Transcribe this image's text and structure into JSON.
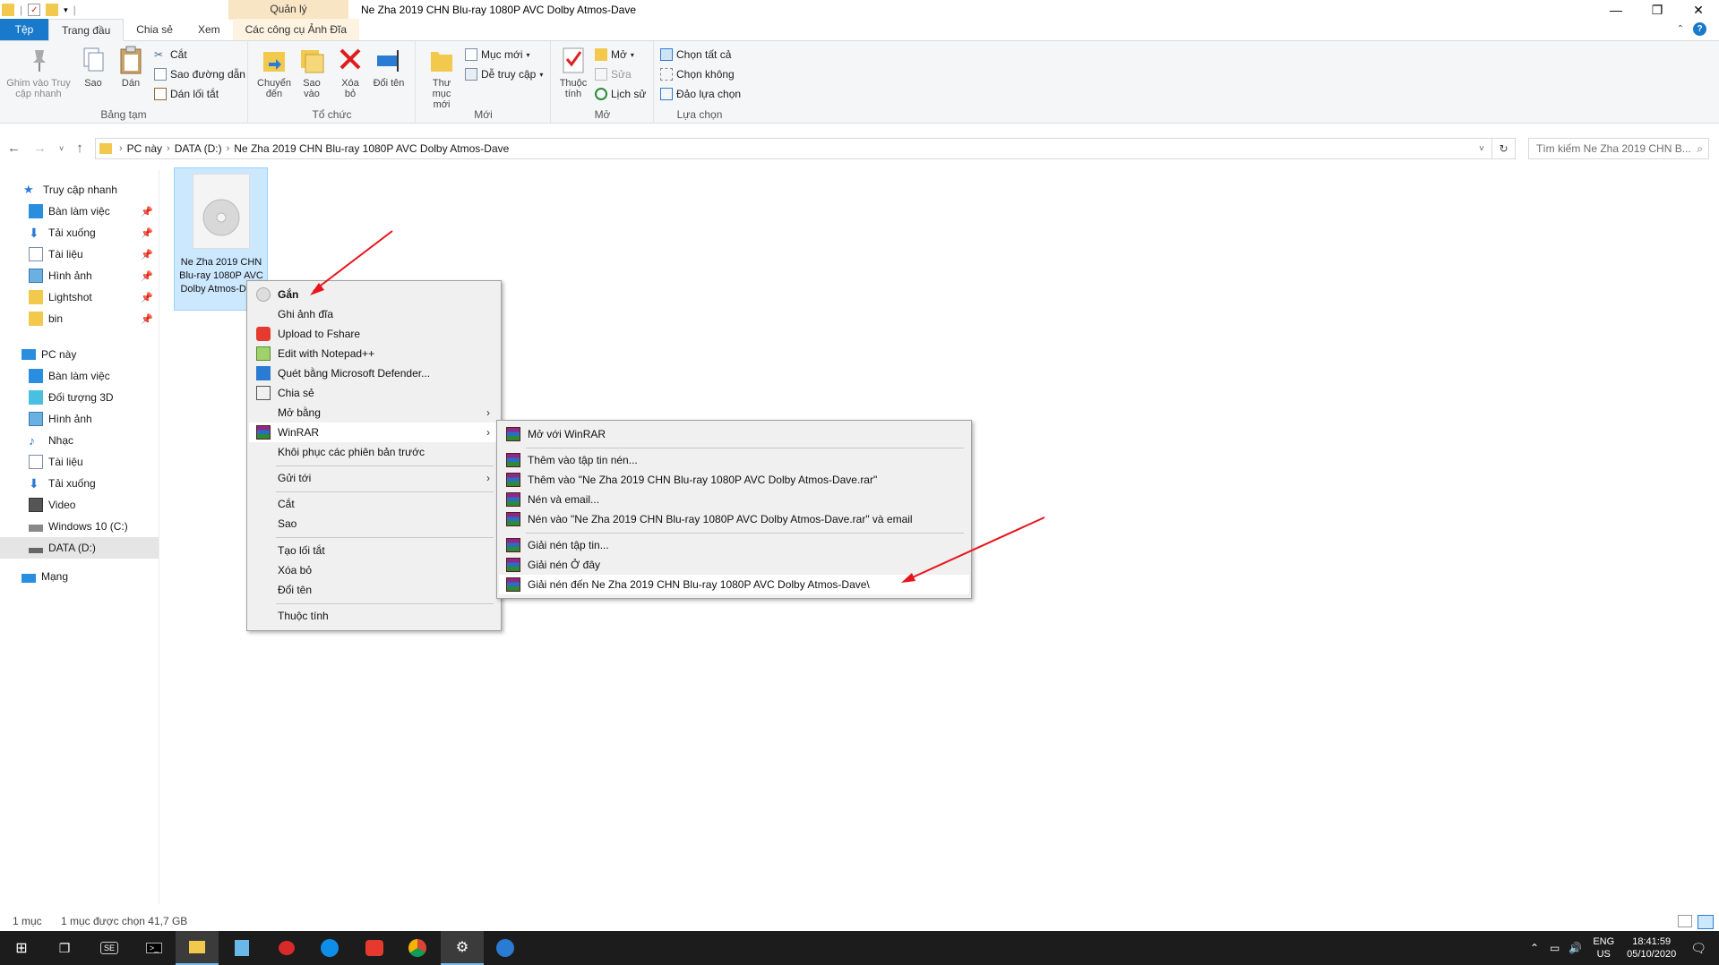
{
  "window": {
    "title": "Ne Zha 2019 CHN Blu-ray 1080P AVC Dolby Atmos-Dave",
    "context_header": "Quản lý"
  },
  "tabs": [
    {
      "label": "Tệp"
    },
    {
      "label": "Trang đầu"
    },
    {
      "label": "Chia sẻ"
    },
    {
      "label": "Xem"
    },
    {
      "label": "Các công cụ Ảnh Đĩa"
    }
  ],
  "ribbon": {
    "clipboard": {
      "pin": "Ghim vào Truy cập nhanh",
      "copy": "Sao",
      "paste": "Dán",
      "cut": "Cắt",
      "copy_path": "Sao đường dẫn",
      "paste_shortcut": "Dán lối tắt",
      "group": "Bảng tạm"
    },
    "organize": {
      "move": "Chuyển đến",
      "copy": "Sao vào",
      "delete": "Xóa bỏ",
      "rename": "Đổi tên",
      "group": "Tổ chức"
    },
    "new": {
      "folder": "Thư mục mới",
      "item": "Mục mới",
      "easy_access": "Dễ truy cập",
      "group": "Mới"
    },
    "open": {
      "properties": "Thuộc tính",
      "open": "Mở",
      "edit": "Sửa",
      "history": "Lịch sử",
      "group": "Mở"
    },
    "select": {
      "all": "Chọn tất cả",
      "none": "Chọn không",
      "invert": "Đảo lựa chọn",
      "group": "Lựa chọn"
    }
  },
  "address": {
    "crumbs": [
      "PC này",
      "DATA (D:)",
      "Ne Zha 2019 CHN Blu-ray 1080P AVC Dolby Atmos-Dave"
    ],
    "search_placeholder": "Tìm kiếm Ne Zha 2019 CHN B..."
  },
  "nav": {
    "quick_access": "Truy cập nhanh",
    "quick_items": [
      "Bàn làm việc",
      "Tải xuống",
      "Tài liệu",
      "Hình ảnh",
      "Lightshot",
      "bin"
    ],
    "this_pc": "PC này",
    "pc_items": [
      "Bàn làm việc",
      "Đối tượng 3D",
      "Hình ảnh",
      "Nhạc",
      "Tài liệu",
      "Tải xuống",
      "Video",
      "Windows 10 (C:)",
      "DATA (D:)"
    ],
    "network": "Mạng"
  },
  "file": {
    "name": "Ne Zha 2019 CHN Blu-ray 1080P AVC Dolby Atmos-Dave"
  },
  "context_menu": {
    "items": [
      "Gắn",
      "Ghi ảnh đĩa",
      "Upload to Fshare",
      "Edit with Notepad++",
      "Quét bằng Microsoft Defender...",
      "Chia sẻ",
      "Mở bằng",
      "WinRAR",
      "Khôi phục các phiên bản trước",
      "Gửi tới",
      "Cắt",
      "Sao",
      "Tạo lối tắt",
      "Xóa bỏ",
      "Đổi tên",
      "Thuộc tính"
    ]
  },
  "winrar_menu": {
    "items": [
      "Mở với WinRAR",
      "Thêm vào tập tin nén...",
      "Thêm vào \"Ne Zha 2019 CHN Blu-ray 1080P AVC Dolby Atmos-Dave.rar\"",
      "Nén và email...",
      "Nén vào \"Ne Zha 2019 CHN Blu-ray 1080P AVC Dolby Atmos-Dave.rar\" và email",
      "Giải nén tập tin...",
      "Giải nén Ở đây",
      "Giải nén đến Ne Zha 2019 CHN Blu-ray 1080P AVC Dolby Atmos-Dave\\"
    ]
  },
  "status": {
    "count": "1 mục",
    "selected": "1 mục được chọn  41,7 GB"
  },
  "tray": {
    "lang": "ENG",
    "region": "US",
    "time": "18:41:59",
    "date": "05/10/2020"
  },
  "colors": {
    "accent": "#1979ca",
    "selection": "#cce8ff",
    "arrow": "#e8141c",
    "taskbar": "#1c1c1c"
  }
}
